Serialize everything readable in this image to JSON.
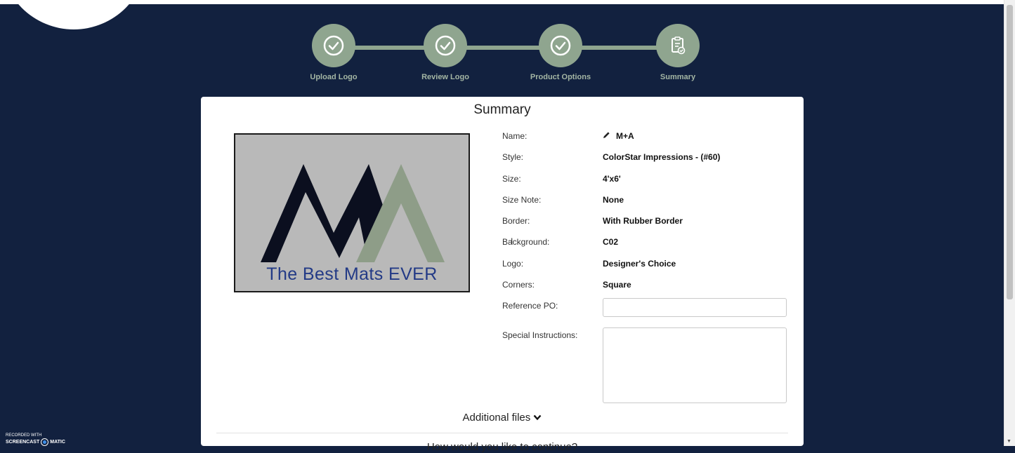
{
  "stepper": {
    "steps": [
      {
        "label": "Upload Logo",
        "icon": "check-circle-icon",
        "done": true
      },
      {
        "label": "Review Logo",
        "icon": "check-circle-icon",
        "done": true
      },
      {
        "label": "Product Options",
        "icon": "check-circle-icon",
        "done": true
      },
      {
        "label": "Summary",
        "icon": "clipboard-check-icon",
        "done": false
      }
    ],
    "color": "#8fa58f"
  },
  "summary": {
    "title": "Summary",
    "logo_text": "The Best Mats EVER",
    "fields": [
      {
        "label": "Name:",
        "value": "M+A"
      },
      {
        "label": "Style:",
        "value": "ColorStar Impressions - (#60)"
      },
      {
        "label": "Size:",
        "value": "4'x6'"
      },
      {
        "label": "Size Note:",
        "value": "None"
      },
      {
        "label": "Border:",
        "value": "With Rubber Border"
      },
      {
        "label": "Background:",
        "value": "C02"
      },
      {
        "label": "Logo:",
        "value": "Designer's Choice"
      },
      {
        "label": "Corners:",
        "value": "Square"
      }
    ],
    "reference_po": {
      "label": "Reference PO:",
      "value": ""
    },
    "special_instructions": {
      "label": "Special Instructions:",
      "value": ""
    },
    "additional_files": "Additional files",
    "next_question": "How would you like to continue?"
  },
  "watermark": {
    "line1": "RECORDED WITH",
    "brand_a": "SCREENCAST",
    "brand_b": "MATIC"
  },
  "colors": {
    "background": "#12213f",
    "accent": "#8fa58f",
    "logo_text": "#233a86"
  }
}
